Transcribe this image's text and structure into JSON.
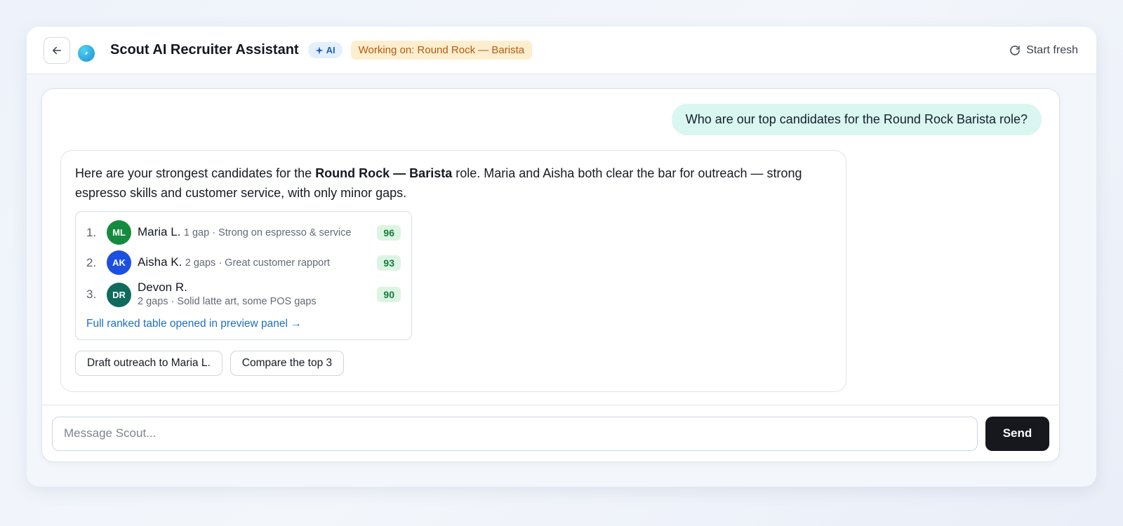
{
  "header": {
    "title": "Scout AI Recruiter Assistant",
    "ai_badge": "AI",
    "context_badge": "Working on: Round Rock — Barista",
    "start_fresh": "Start fresh"
  },
  "conversation": {
    "user_message": "Who are our top candidates for the Round Rock Barista role?",
    "assistant": {
      "intro_before": "Here are your strongest candidates for the ",
      "intro_bold": "Round Rock — Barista",
      "intro_after": " role. Maria and Aisha both clear the bar for outreach — strong espresso skills and customer service, with only minor gaps.",
      "candidates": [
        {
          "rank": "1.",
          "initials": "ML",
          "name": "Maria L.",
          "meta": "1 gap · Strong on espresso & service",
          "score": "96",
          "avatar_color": "#168a3e"
        },
        {
          "rank": "2.",
          "initials": "AK",
          "name": "Aisha K.",
          "meta": "2 gaps · Great customer rapport",
          "score": "93",
          "avatar_color": "#1d4fe0"
        },
        {
          "rank": "3.",
          "initials": "DR",
          "name": "Devon R.",
          "meta": "2 gaps · Solid latte art, some POS gaps",
          "score": "90",
          "avatar_color": "#0f6b5c"
        }
      ],
      "full_table_link": "Full ranked table opened in preview panel →",
      "actions": [
        "Draft outreach to Maria L.",
        "Compare the top 3"
      ]
    }
  },
  "composer": {
    "placeholder": "Message Scout...",
    "send_label": "Send"
  },
  "icons": {
    "back": "arrow-left-icon",
    "logo": "compass-icon",
    "ai": "sparkle-icon",
    "start_fresh": "refresh-icon"
  }
}
